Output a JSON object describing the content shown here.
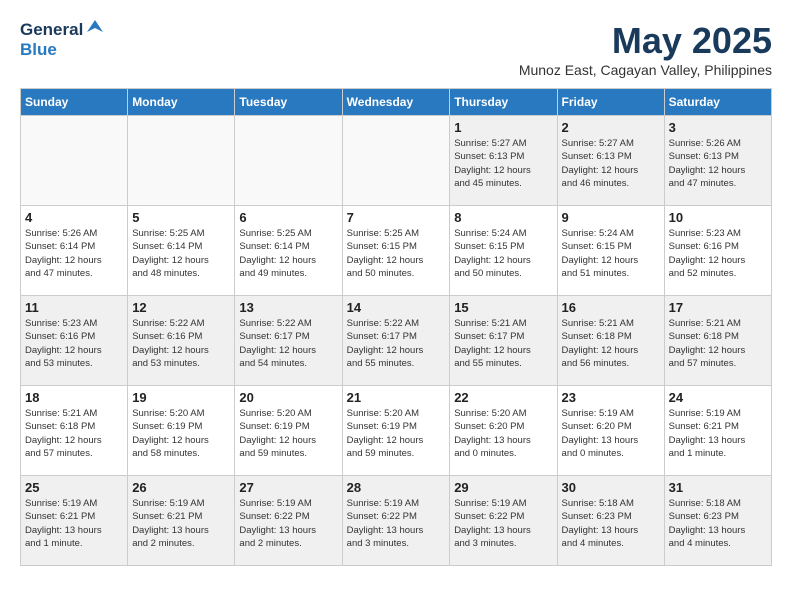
{
  "logo": {
    "general": "General",
    "blue": "Blue"
  },
  "title": "May 2025",
  "location": "Munoz East, Cagayan Valley, Philippines",
  "days_header": [
    "Sunday",
    "Monday",
    "Tuesday",
    "Wednesday",
    "Thursday",
    "Friday",
    "Saturday"
  ],
  "weeks": [
    [
      {
        "num": "",
        "info": ""
      },
      {
        "num": "",
        "info": ""
      },
      {
        "num": "",
        "info": ""
      },
      {
        "num": "",
        "info": ""
      },
      {
        "num": "1",
        "info": "Sunrise: 5:27 AM\nSunset: 6:13 PM\nDaylight: 12 hours\nand 45 minutes."
      },
      {
        "num": "2",
        "info": "Sunrise: 5:27 AM\nSunset: 6:13 PM\nDaylight: 12 hours\nand 46 minutes."
      },
      {
        "num": "3",
        "info": "Sunrise: 5:26 AM\nSunset: 6:13 PM\nDaylight: 12 hours\nand 47 minutes."
      }
    ],
    [
      {
        "num": "4",
        "info": "Sunrise: 5:26 AM\nSunset: 6:14 PM\nDaylight: 12 hours\nand 47 minutes."
      },
      {
        "num": "5",
        "info": "Sunrise: 5:25 AM\nSunset: 6:14 PM\nDaylight: 12 hours\nand 48 minutes."
      },
      {
        "num": "6",
        "info": "Sunrise: 5:25 AM\nSunset: 6:14 PM\nDaylight: 12 hours\nand 49 minutes."
      },
      {
        "num": "7",
        "info": "Sunrise: 5:25 AM\nSunset: 6:15 PM\nDaylight: 12 hours\nand 50 minutes."
      },
      {
        "num": "8",
        "info": "Sunrise: 5:24 AM\nSunset: 6:15 PM\nDaylight: 12 hours\nand 50 minutes."
      },
      {
        "num": "9",
        "info": "Sunrise: 5:24 AM\nSunset: 6:15 PM\nDaylight: 12 hours\nand 51 minutes."
      },
      {
        "num": "10",
        "info": "Sunrise: 5:23 AM\nSunset: 6:16 PM\nDaylight: 12 hours\nand 52 minutes."
      }
    ],
    [
      {
        "num": "11",
        "info": "Sunrise: 5:23 AM\nSunset: 6:16 PM\nDaylight: 12 hours\nand 53 minutes."
      },
      {
        "num": "12",
        "info": "Sunrise: 5:22 AM\nSunset: 6:16 PM\nDaylight: 12 hours\nand 53 minutes."
      },
      {
        "num": "13",
        "info": "Sunrise: 5:22 AM\nSunset: 6:17 PM\nDaylight: 12 hours\nand 54 minutes."
      },
      {
        "num": "14",
        "info": "Sunrise: 5:22 AM\nSunset: 6:17 PM\nDaylight: 12 hours\nand 55 minutes."
      },
      {
        "num": "15",
        "info": "Sunrise: 5:21 AM\nSunset: 6:17 PM\nDaylight: 12 hours\nand 55 minutes."
      },
      {
        "num": "16",
        "info": "Sunrise: 5:21 AM\nSunset: 6:18 PM\nDaylight: 12 hours\nand 56 minutes."
      },
      {
        "num": "17",
        "info": "Sunrise: 5:21 AM\nSunset: 6:18 PM\nDaylight: 12 hours\nand 57 minutes."
      }
    ],
    [
      {
        "num": "18",
        "info": "Sunrise: 5:21 AM\nSunset: 6:18 PM\nDaylight: 12 hours\nand 57 minutes."
      },
      {
        "num": "19",
        "info": "Sunrise: 5:20 AM\nSunset: 6:19 PM\nDaylight: 12 hours\nand 58 minutes."
      },
      {
        "num": "20",
        "info": "Sunrise: 5:20 AM\nSunset: 6:19 PM\nDaylight: 12 hours\nand 59 minutes."
      },
      {
        "num": "21",
        "info": "Sunrise: 5:20 AM\nSunset: 6:19 PM\nDaylight: 12 hours\nand 59 minutes."
      },
      {
        "num": "22",
        "info": "Sunrise: 5:20 AM\nSunset: 6:20 PM\nDaylight: 13 hours\nand 0 minutes."
      },
      {
        "num": "23",
        "info": "Sunrise: 5:19 AM\nSunset: 6:20 PM\nDaylight: 13 hours\nand 0 minutes."
      },
      {
        "num": "24",
        "info": "Sunrise: 5:19 AM\nSunset: 6:21 PM\nDaylight: 13 hours\nand 1 minute."
      }
    ],
    [
      {
        "num": "25",
        "info": "Sunrise: 5:19 AM\nSunset: 6:21 PM\nDaylight: 13 hours\nand 1 minute."
      },
      {
        "num": "26",
        "info": "Sunrise: 5:19 AM\nSunset: 6:21 PM\nDaylight: 13 hours\nand 2 minutes."
      },
      {
        "num": "27",
        "info": "Sunrise: 5:19 AM\nSunset: 6:22 PM\nDaylight: 13 hours\nand 2 minutes."
      },
      {
        "num": "28",
        "info": "Sunrise: 5:19 AM\nSunset: 6:22 PM\nDaylight: 13 hours\nand 3 minutes."
      },
      {
        "num": "29",
        "info": "Sunrise: 5:19 AM\nSunset: 6:22 PM\nDaylight: 13 hours\nand 3 minutes."
      },
      {
        "num": "30",
        "info": "Sunrise: 5:18 AM\nSunset: 6:23 PM\nDaylight: 13 hours\nand 4 minutes."
      },
      {
        "num": "31",
        "info": "Sunrise: 5:18 AM\nSunset: 6:23 PM\nDaylight: 13 hours\nand 4 minutes."
      }
    ]
  ]
}
